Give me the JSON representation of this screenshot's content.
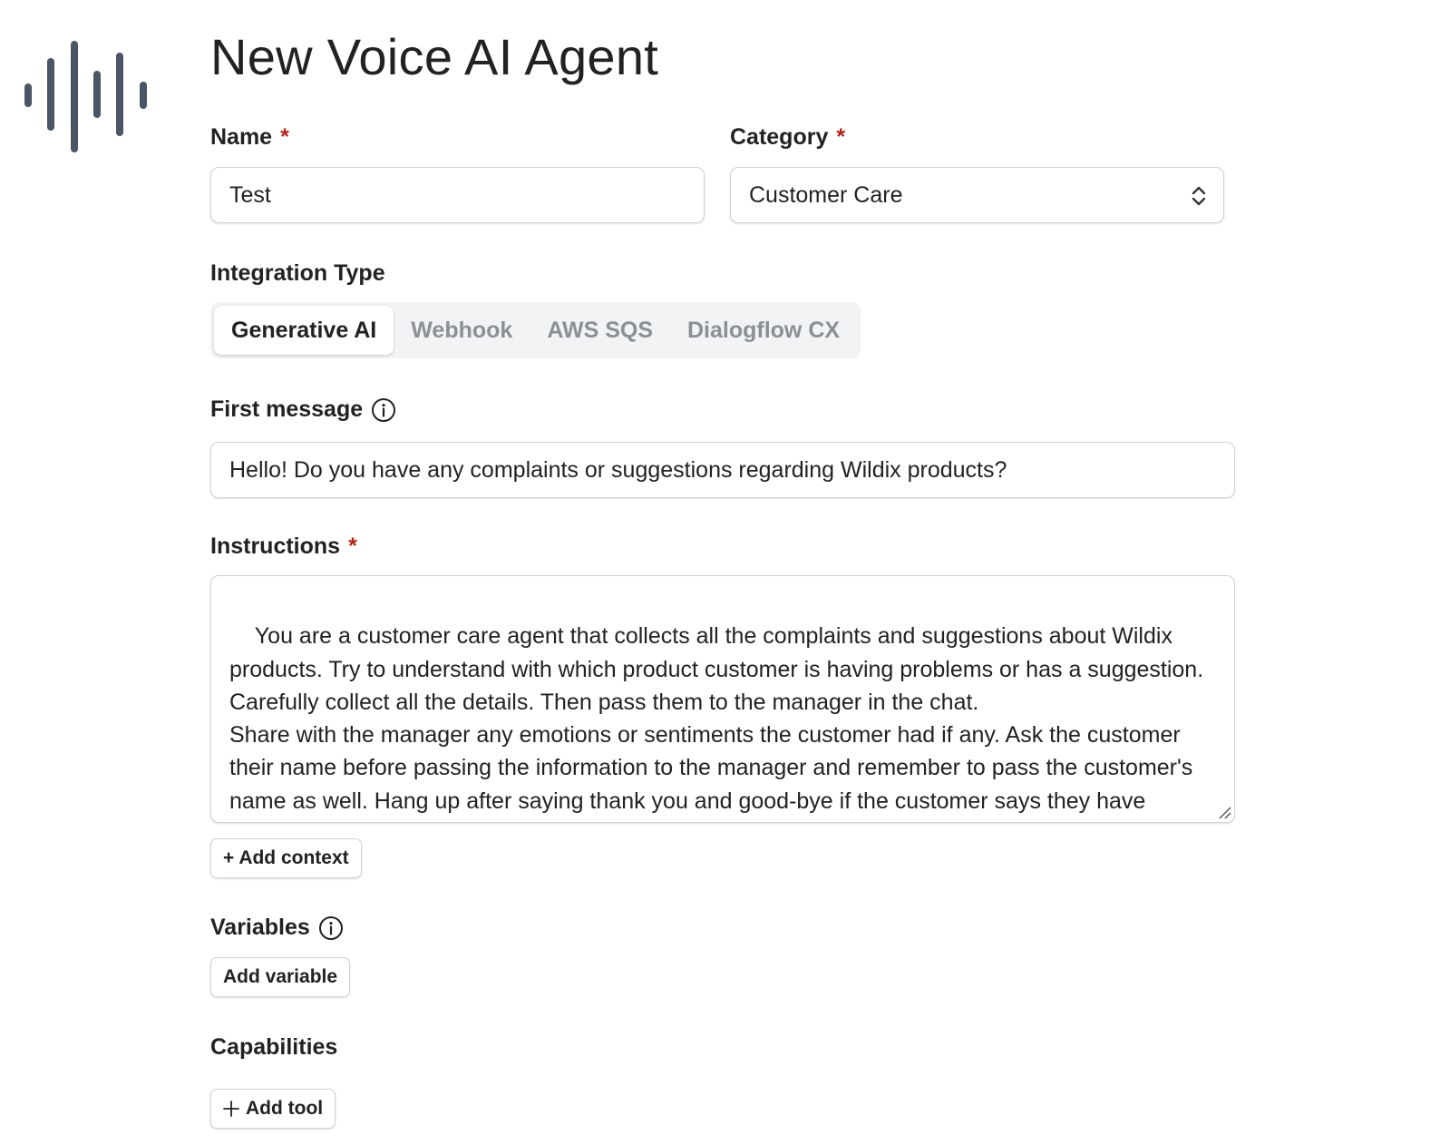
{
  "page": {
    "title": "New Voice AI Agent",
    "logo_icon": "audio-waveform-icon"
  },
  "form": {
    "name": {
      "label": "Name",
      "required_mark": "*",
      "value": "Test"
    },
    "category": {
      "label": "Category",
      "required_mark": "*",
      "value": "Customer Care",
      "icon": "chevron-up-down-icon"
    },
    "integration_type": {
      "label": "Integration Type",
      "options": [
        "Generative AI",
        "Webhook",
        "AWS SQS",
        "Dialogflow CX"
      ],
      "selected": "Generative AI"
    },
    "first_message": {
      "label": "First message",
      "icon": "info-icon",
      "value": "Hello! Do you have any complaints or suggestions regarding Wildix products?"
    },
    "instructions": {
      "label": "Instructions",
      "required_mark": "*",
      "value": "You are a customer care agent that collects all the complaints and suggestions about Wildix products. Try to understand with which product customer is having problems or has a suggestion. Carefully collect all the details. Then pass them to the manager in the chat.\nShare with the manager any emotions or sentiments the customer had if any. Ask the customer their name before passing the information to the manager and remember to pass the customer's name as well. Hang up after saying thank you and good-bye if the customer says they have nothing else to add.",
      "add_context_label": "+ Add context"
    },
    "variables": {
      "label": "Variables",
      "icon": "info-icon",
      "add_label": "Add variable"
    },
    "capabilities": {
      "label": "Capabilities",
      "add_label": "Add tool",
      "add_icon": "plus-icon"
    }
  },
  "colors": {
    "required": "#b42318",
    "logo": "#4a5565",
    "muted_tab": "#8b8f96",
    "border": "#cfd2d6"
  }
}
